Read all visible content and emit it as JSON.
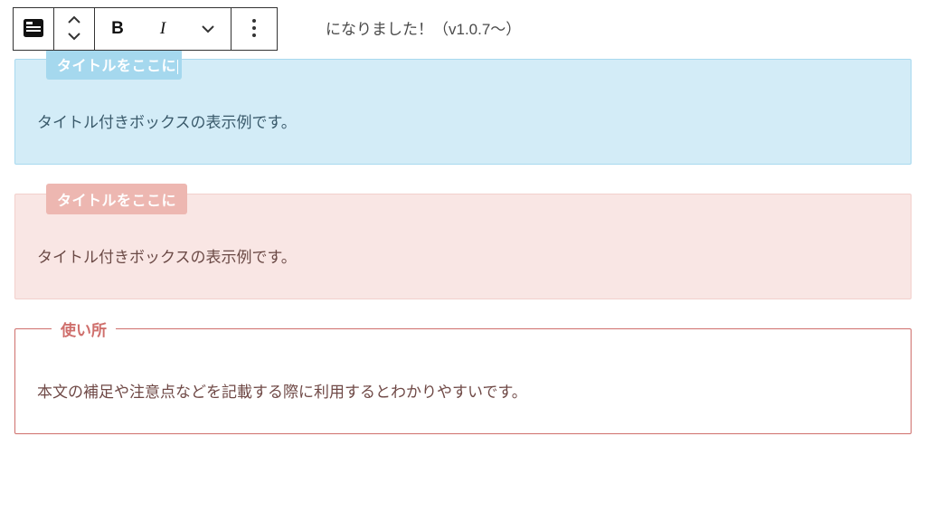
{
  "heading": "になりました！（v1.0.7〜）",
  "toolbar": {
    "block_icon": "block-card-icon",
    "move_up": "chevron-up-icon",
    "move_down": "chevron-down-icon",
    "bold": "B",
    "italic": "I",
    "more_format": "chevron-down-icon",
    "options": "kebab-icon"
  },
  "boxes": [
    {
      "title": "タイトルをここに",
      "body": "タイトル付きボックスの表示例です。",
      "style": "blue",
      "editing": true
    },
    {
      "title": "タイトルをここに",
      "body": "タイトル付きボックスの表示例です。",
      "style": "pink",
      "editing": false
    },
    {
      "title": "使い所",
      "body": "本文の補足や注意点などを記載する際に利用するとわかりやすいです。",
      "style": "fieldset",
      "editing": false
    }
  ]
}
